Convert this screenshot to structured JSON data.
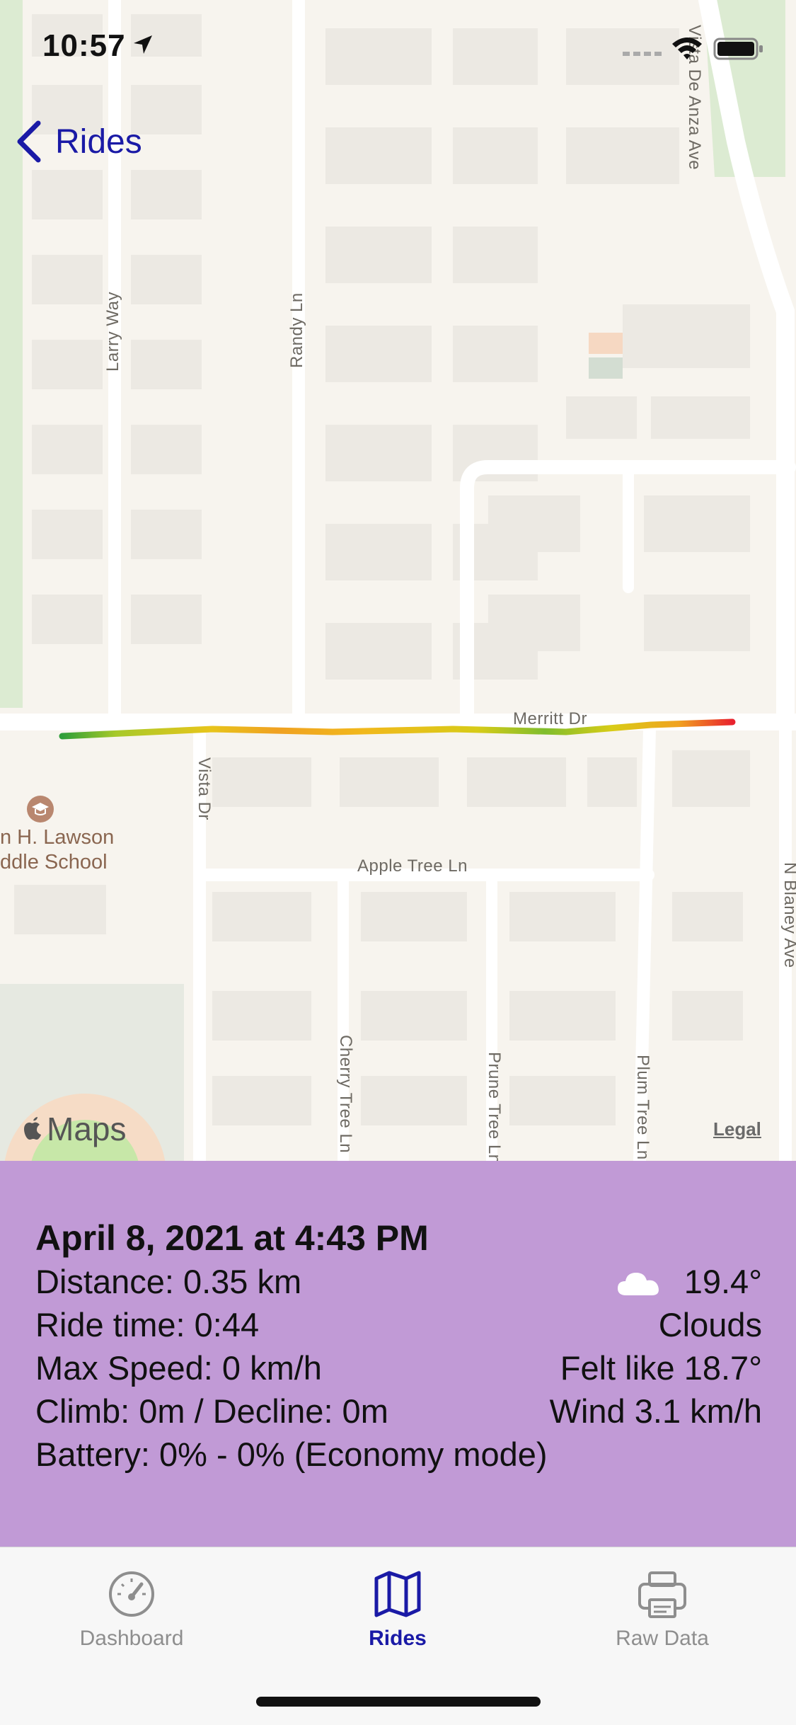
{
  "status": {
    "time": "10:57"
  },
  "nav": {
    "back_label": "Rides"
  },
  "map": {
    "streets": {
      "larry": "Larry Way",
      "randy": "Randy Ln",
      "vistadeanza": "Vista De Anza Ave",
      "merritt": "Merritt Dr",
      "vista": "Vista Dr",
      "appletree": "Apple Tree Ln",
      "cherry": "Cherry Tree Ln",
      "prune": "Prune Tree Ln",
      "plum": "Plum Tree Ln",
      "blaney": "N Blaney Ave"
    },
    "poi_line1": "n H. Lawson",
    "poi_line2": "ddle School",
    "attribution": "Maps",
    "legal": "Legal"
  },
  "ride": {
    "title": "April 8, 2021 at 4:43 PM",
    "distance": "Distance: 0.35 km",
    "ride_time": "Ride time: 0:44",
    "max_speed": "Max Speed: 0 km/h",
    "climb": "Climb: 0m / Decline: 0m",
    "battery": "Battery: 0% - 0% (Economy mode)",
    "weather": {
      "icon": "cloud-icon",
      "temperature": "19.4°",
      "condition": "Clouds",
      "felt": "Felt like 18.7°",
      "wind": "Wind 3.1 km/h"
    }
  },
  "tabs": [
    {
      "label": "Dashboard",
      "icon": "speedometer-icon",
      "active": false
    },
    {
      "label": "Rides",
      "icon": "map-icon",
      "active": true
    },
    {
      "label": "Raw Data",
      "icon": "printer-icon",
      "active": false
    }
  ],
  "colors": {
    "accent": "#1a1aa6",
    "panel": "#c19ad6",
    "inactive_tab": "#8e8e8e"
  }
}
